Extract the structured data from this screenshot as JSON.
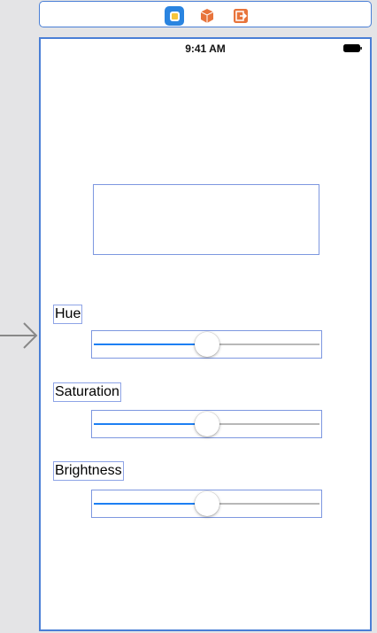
{
  "scene_dock": {
    "items": [
      {
        "icon": "view-controller-icon",
        "color": "#2a84e0"
      },
      {
        "icon": "first-responder-icon",
        "color": "#e8743b"
      },
      {
        "icon": "exit-icon",
        "color": "#e8743b"
      }
    ]
  },
  "status_bar": {
    "time": "9:41 AM",
    "battery_icon": "battery-icon"
  },
  "colors": {
    "selection_outline": "#4a7fd6",
    "slider_min_track": "#1d7ff3",
    "slider_max_track": "#b8b8b8"
  },
  "sliders": {
    "hue": {
      "label": "Hue",
      "value": 0.5
    },
    "saturation": {
      "label": "Saturation",
      "value": 0.5
    },
    "brightness": {
      "label": "Brightness",
      "value": 0.5
    }
  }
}
